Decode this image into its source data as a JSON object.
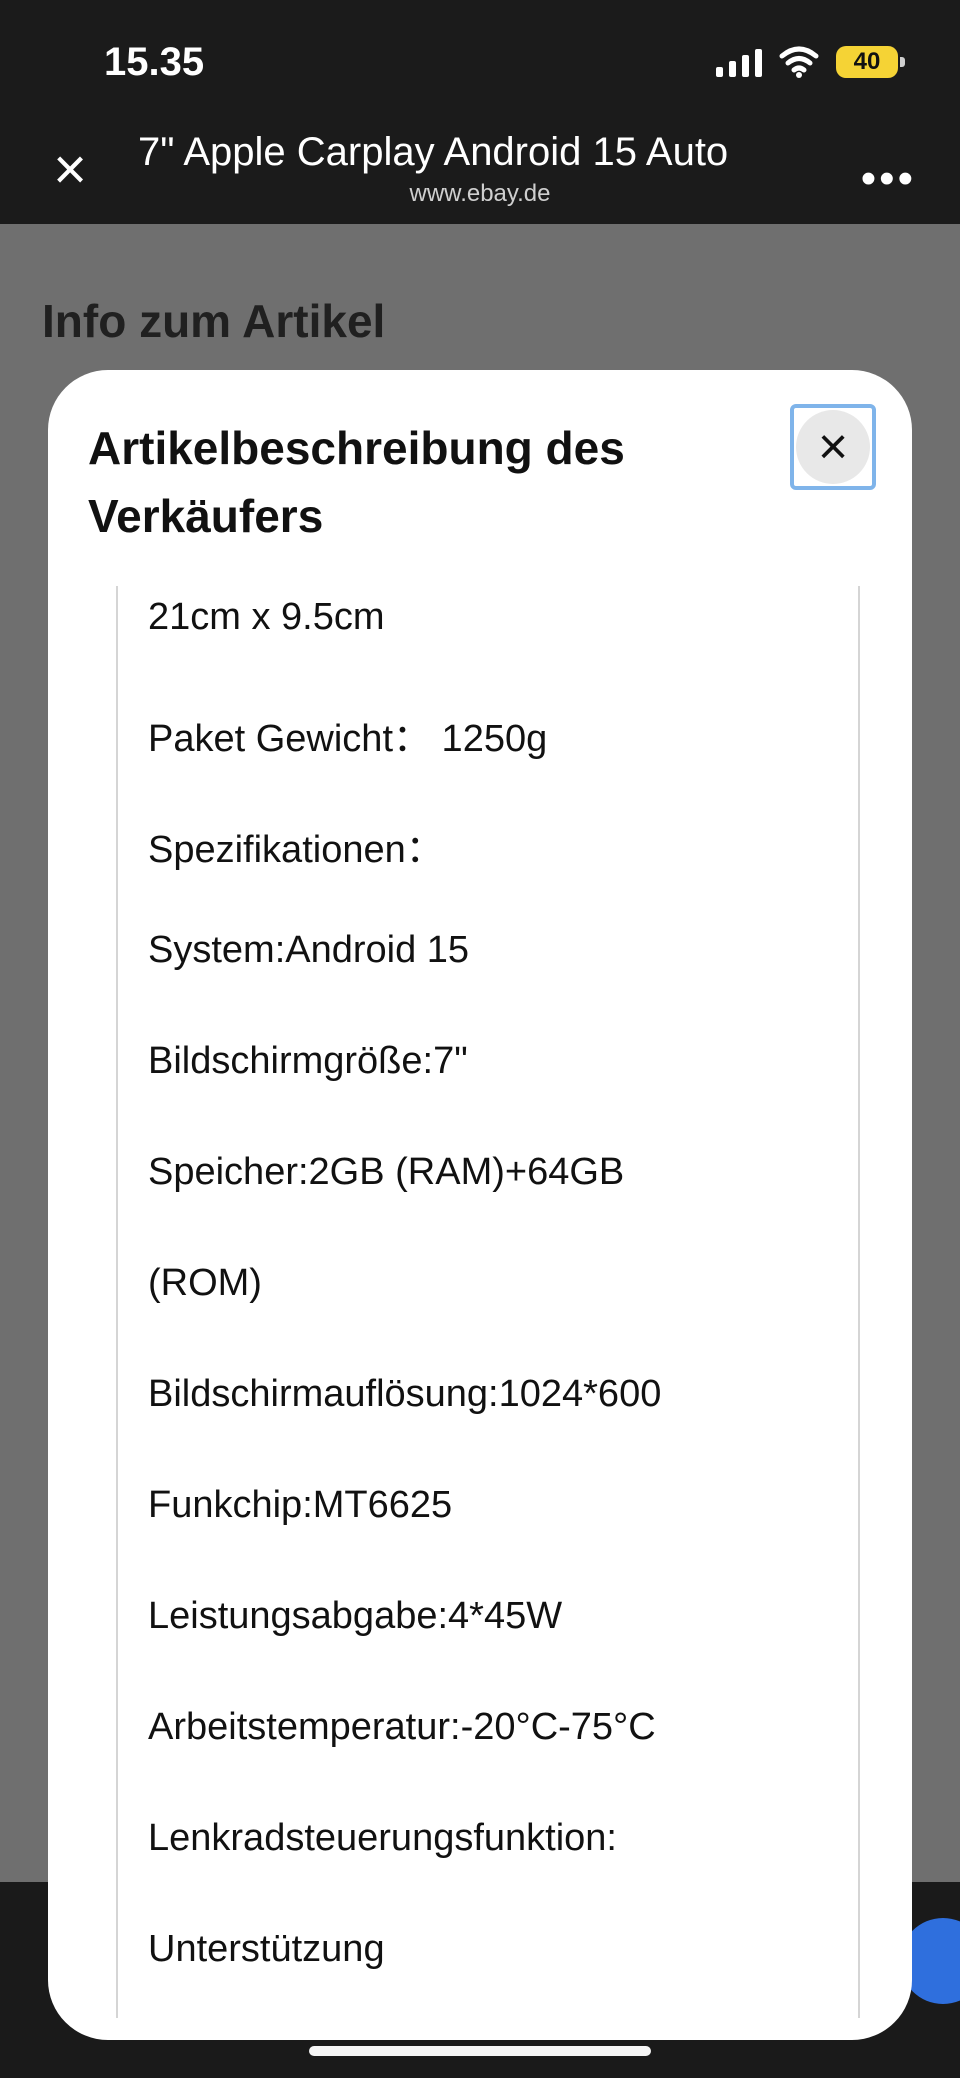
{
  "status": {
    "time": "15.35",
    "battery": "40"
  },
  "browser": {
    "title": "7\" Apple Carplay Android 15 Auto",
    "url": "www.ebay.de"
  },
  "background": {
    "heading": "Info zum Artikel"
  },
  "modal": {
    "title": "Artikelbeschreibung des Verkäufers",
    "lines": [
      "21cm x 9.5cm",
      "Paket Gewicht：  1250g",
      "Spezifikationen：",
      "System:Android 15",
      "Bildschirmgröße:7\"",
      "Speicher:2GB (RAM)+64GB",
      "(ROM)",
      "Bildschirmauflösung:1024*600",
      "Funkchip:MT6625",
      "Leistungsabgabe:4*45W",
      "Arbeitstemperatur:-20°C-75°C",
      "Lenkradsteuerungsfunktion:",
      "Unterstützung"
    ]
  },
  "icons": {
    "signal": "signal-icon",
    "wifi": "wifi-icon",
    "battery": "battery-icon",
    "close": "close-icon",
    "more": "more-icon"
  }
}
